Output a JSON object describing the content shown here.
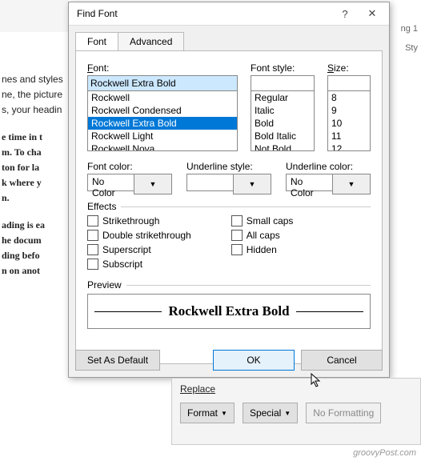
{
  "dialog": {
    "title": "Find Font",
    "tabs": {
      "font": "Font",
      "advanced": "Advanced"
    },
    "fontLabel": "Font:",
    "fontValue": "Rockwell Extra Bold",
    "fontList": [
      "Rockwell",
      "Rockwell Condensed",
      "Rockwell Extra Bold",
      "Rockwell Light",
      "Rockwell Nova"
    ],
    "fontStyleLabel": "Font style:",
    "fontStyleList": [
      "Regular",
      "Italic",
      "Bold",
      "Bold Italic",
      "Not Bold"
    ],
    "sizeLabel": "Size:",
    "sizeList": [
      "8",
      "9",
      "10",
      "11",
      "12"
    ],
    "fontColorLabel": "Font color:",
    "fontColorValue": "No Color",
    "underlineStyleLabel": "Underline style:",
    "underlineStyleValue": "",
    "underlineColorLabel": "Underline color:",
    "underlineColorValue": "No Color",
    "effectsLabel": "Effects",
    "effects": {
      "strike": "Strikethrough",
      "dstrike": "Double strikethrough",
      "super": "Superscript",
      "sub": "Subscript",
      "smallcaps": "Small caps",
      "allcaps": "All caps",
      "hidden": "Hidden"
    },
    "previewLabel": "Preview",
    "previewText": "Rockwell Extra Bold",
    "setDefault": "Set As Default",
    "ok": "OK",
    "cancel": "Cancel"
  },
  "replace": {
    "title": "Replace",
    "format": "Format",
    "special": "Special",
    "noformat": "No Formatting"
  },
  "doc": {
    "p1a": "nes and styles",
    "p1b": "ne, the picture",
    "p1c": "s, your headin",
    "p2a": "e time in t",
    "p2b": "m. To cha",
    "p2c": "ton for la",
    "p2d": "k where y",
    "p2e": "n.",
    "p3a": "ading is ea",
    "p3b": "he docum",
    "p3c": "ding befo",
    "p3d": "n on anot"
  },
  "side": {
    "s1": "ng 1",
    "s2": "Sty"
  },
  "watermark": "groovyPost.com"
}
